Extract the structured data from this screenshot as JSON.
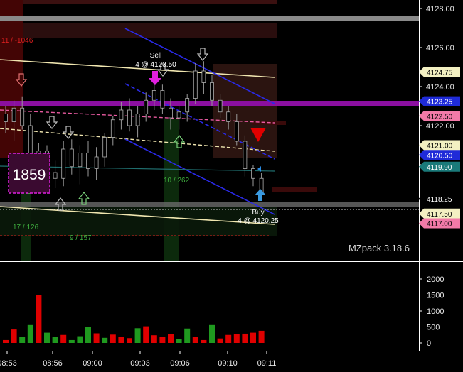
{
  "chart_data": {
    "type": "candlestick",
    "title": "",
    "price_axis": {
      "ticks": [
        "4128.00",
        "4126.00",
        "4124.00",
        "4122.00",
        "4120.00"
      ],
      "ylim": [
        4116.2,
        4128.4
      ]
    },
    "volume_axis": {
      "ticks": [
        "2000",
        "1500",
        "1000",
        "500",
        "0"
      ],
      "ylim": [
        0,
        2100
      ]
    },
    "time_axis": {
      "ticks": [
        "08:53",
        "08:56",
        "09:00",
        "09:03",
        "09:06",
        "09:10",
        "09:11"
      ]
    },
    "price_tags": [
      {
        "label": "4124.75",
        "value": 4124.75,
        "bg": "#f3f0c2",
        "fg": "#000000"
      },
      {
        "label": "4123.25",
        "value": 4123.25,
        "bg": "#1f2bd8",
        "fg": "#ffffff"
      },
      {
        "label": "4122.50",
        "value": 4122.5,
        "bg": "#f27aa8",
        "fg": "#000000"
      },
      {
        "label": "4121.00",
        "value": 4121.0,
        "bg": "#f3f0c2",
        "fg": "#000000"
      },
      {
        "label": "4120.50",
        "value": 4120.5,
        "bg": "#1f2bd8",
        "fg": "#ffffff"
      },
      {
        "label": "4119.90",
        "value": 4119.9,
        "bg": "#1a7a7a",
        "fg": "#ffffff"
      },
      {
        "label": "4118.25",
        "value": 4118.25,
        "bg": "#000000",
        "fg": "#ffffff"
      },
      {
        "label": "4117.50",
        "value": 4117.5,
        "bg": "#f3f0c2",
        "fg": "#000000"
      },
      {
        "label": "4117.00",
        "value": 4117.0,
        "bg": "#f27aa8",
        "fg": "#000000"
      }
    ],
    "annotations": [
      {
        "text": "11 / -1046",
        "color": "#e02020"
      },
      {
        "text": "Sell",
        "color": "#ffffff"
      },
      {
        "text": "4 @ 4123.50",
        "color": "#ffffff"
      },
      {
        "text": "Buy",
        "color": "#ffffff"
      },
      {
        "text": "4 @ 4120.25",
        "color": "#ffffff"
      },
      {
        "text": "10 / 262",
        "color": "#3fae3f"
      },
      {
        "text": "17 / 126",
        "color": "#3fae3f"
      },
      {
        "text": "9 / 157",
        "color": "#3fae3f"
      },
      {
        "text": "1859",
        "color": "#ffffff"
      }
    ],
    "watermark": "MZpack 3.18.6",
    "candles": [
      {
        "o": 4122.6,
        "h": 4123.0,
        "l": 4121.6,
        "c": 4122.2
      },
      {
        "o": 4122.2,
        "h": 4123.3,
        "l": 4121.2,
        "c": 4122.9
      },
      {
        "o": 4122.9,
        "h": 4123.5,
        "l": 4121.8,
        "c": 4122.0
      },
      {
        "o": 4122.0,
        "h": 4122.6,
        "l": 4119.7,
        "c": 4120.1
      },
      {
        "o": 4120.1,
        "h": 4121.1,
        "l": 4119.3,
        "c": 4120.7
      },
      {
        "o": 4120.7,
        "h": 4121.0,
        "l": 4119.2,
        "c": 4119.6
      },
      {
        "o": 4119.6,
        "h": 4120.2,
        "l": 4118.8,
        "c": 4119.3
      },
      {
        "o": 4119.3,
        "h": 4121.2,
        "l": 4118.9,
        "c": 4120.8
      },
      {
        "o": 4120.8,
        "h": 4121.3,
        "l": 4119.5,
        "c": 4119.9
      },
      {
        "o": 4119.9,
        "h": 4121.0,
        "l": 4119.0,
        "c": 4120.6
      },
      {
        "o": 4120.6,
        "h": 4121.2,
        "l": 4119.4,
        "c": 4119.8
      },
      {
        "o": 4119.8,
        "h": 4120.9,
        "l": 4119.2,
        "c": 4120.4
      },
      {
        "o": 4120.4,
        "h": 4121.6,
        "l": 4119.9,
        "c": 4121.4
      },
      {
        "o": 4121.4,
        "h": 4122.5,
        "l": 4121.0,
        "c": 4122.3
      },
      {
        "o": 4122.3,
        "h": 4123.2,
        "l": 4121.8,
        "c": 4122.8
      },
      {
        "o": 4122.8,
        "h": 4123.4,
        "l": 4121.7,
        "c": 4122.0
      },
      {
        "o": 4122.0,
        "h": 4123.0,
        "l": 4121.4,
        "c": 4122.6
      },
      {
        "o": 4122.6,
        "h": 4123.7,
        "l": 4122.2,
        "c": 4123.3
      },
      {
        "o": 4123.3,
        "h": 4124.4,
        "l": 4122.8,
        "c": 4123.8
      },
      {
        "o": 4123.8,
        "h": 4124.1,
        "l": 4122.6,
        "c": 4122.9
      },
      {
        "o": 4122.9,
        "h": 4123.4,
        "l": 4121.8,
        "c": 4122.4
      },
      {
        "o": 4122.4,
        "h": 4123.0,
        "l": 4121.8,
        "c": 4122.7
      },
      {
        "o": 4122.7,
        "h": 4123.6,
        "l": 4122.2,
        "c": 4123.4
      },
      {
        "o": 4123.4,
        "h": 4125.2,
        "l": 4123.1,
        "c": 4124.8
      },
      {
        "o": 4124.8,
        "h": 4125.3,
        "l": 4123.6,
        "c": 4124.2
      },
      {
        "o": 4124.2,
        "h": 4124.6,
        "l": 4123.0,
        "c": 4123.3
      },
      {
        "o": 4123.3,
        "h": 4123.6,
        "l": 4122.4,
        "c": 4122.7
      },
      {
        "o": 4122.7,
        "h": 4123.0,
        "l": 4121.8,
        "c": 4122.2
      },
      {
        "o": 4122.2,
        "h": 4122.6,
        "l": 4121.0,
        "c": 4121.2
      },
      {
        "o": 4121.2,
        "h": 4121.5,
        "l": 4119.4,
        "c": 4119.8
      },
      {
        "o": 4119.8,
        "h": 4120.0,
        "l": 4118.9,
        "c": 4119.3
      },
      {
        "o": 4119.3,
        "h": 4119.6,
        "l": 4118.2,
        "c": 4118.6
      }
    ],
    "volume": [
      {
        "v": 90,
        "up": false
      },
      {
        "v": 420,
        "up": false
      },
      {
        "v": 200,
        "up": true
      },
      {
        "v": 560,
        "up": true
      },
      {
        "v": 1500,
        "up": false
      },
      {
        "v": 320,
        "up": true
      },
      {
        "v": 180,
        "up": true
      },
      {
        "v": 250,
        "up": false
      },
      {
        "v": 90,
        "up": true
      },
      {
        "v": 210,
        "up": true
      },
      {
        "v": 500,
        "up": true
      },
      {
        "v": 300,
        "up": false
      },
      {
        "v": 160,
        "up": true
      },
      {
        "v": 260,
        "up": false
      },
      {
        "v": 200,
        "up": false
      },
      {
        "v": 150,
        "up": false
      },
      {
        "v": 460,
        "up": true
      },
      {
        "v": 520,
        "up": false
      },
      {
        "v": 240,
        "up": false
      },
      {
        "v": 180,
        "up": false
      },
      {
        "v": 270,
        "up": false
      },
      {
        "v": 120,
        "up": true
      },
      {
        "v": 450,
        "up": true
      },
      {
        "v": 200,
        "up": false
      },
      {
        "v": 90,
        "up": false
      },
      {
        "v": 560,
        "up": true
      },
      {
        "v": 140,
        "up": false
      },
      {
        "v": 250,
        "up": false
      },
      {
        "v": 270,
        "up": false
      },
      {
        "v": 290,
        "up": false
      },
      {
        "v": 320,
        "up": false
      },
      {
        "v": 380,
        "up": false
      }
    ]
  }
}
